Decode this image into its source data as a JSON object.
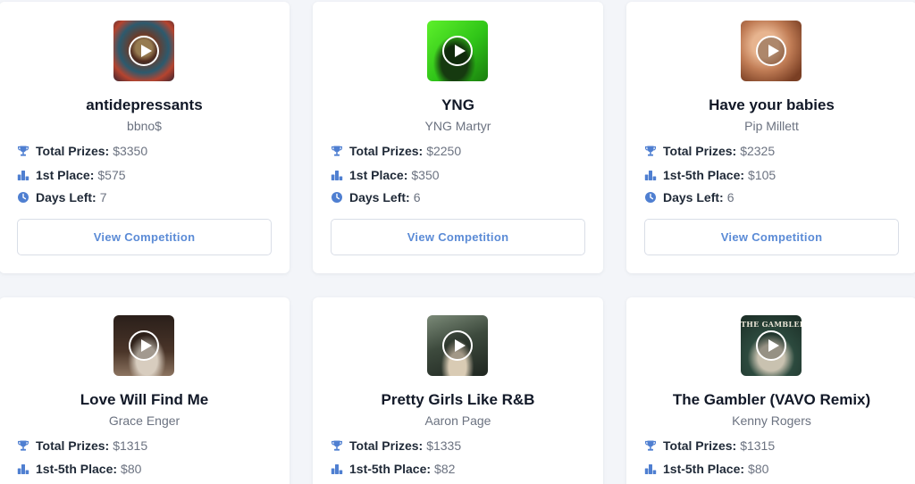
{
  "colors": {
    "accent": "#5b8bd6",
    "icon": "#4f7fd1",
    "title": "#111827",
    "muted": "#6b7280"
  },
  "icons": {
    "prizes": "trophy-icon",
    "place": "podium-icon",
    "days": "clock-icon",
    "thumbnail": "play-icon"
  },
  "cards": [
    {
      "title": "antidepressants",
      "artist": "bbno$",
      "total_label": "Total Prizes:",
      "total_value": "$3350",
      "place_label": "1st Place:",
      "place_value": "$575",
      "days_label": "Days Left:",
      "days_value": "7",
      "button": "View Competition"
    },
    {
      "title": "YNG",
      "artist": "YNG Martyr",
      "total_label": "Total Prizes:",
      "total_value": "$2250",
      "place_label": "1st Place:",
      "place_value": "$350",
      "days_label": "Days Left:",
      "days_value": "6",
      "button": "View Competition"
    },
    {
      "title": "Have your babies",
      "artist": "Pip Millett",
      "total_label": "Total Prizes:",
      "total_value": "$2325",
      "place_label": "1st-5th Place:",
      "place_value": "$105",
      "days_label": "Days Left:",
      "days_value": "6",
      "button": "View Competition"
    },
    {
      "title": "Love Will Find Me",
      "artist": "Grace Enger",
      "total_label": "Total Prizes:",
      "total_value": "$1315",
      "place_label": "1st-5th Place:",
      "place_value": "$80"
    },
    {
      "title": "Pretty Girls Like R&B",
      "artist": "Aaron Page",
      "total_label": "Total Prizes:",
      "total_value": "$1335",
      "place_label": "1st-5th Place:",
      "place_value": "$82"
    },
    {
      "title": "The Gambler (VAVO Remix)",
      "artist": "Kenny Rogers",
      "total_label": "Total Prizes:",
      "total_value": "$1315",
      "place_label": "1st-5th Place:",
      "place_value": "$80",
      "cover_text": "THE GAMBLER"
    }
  ]
}
